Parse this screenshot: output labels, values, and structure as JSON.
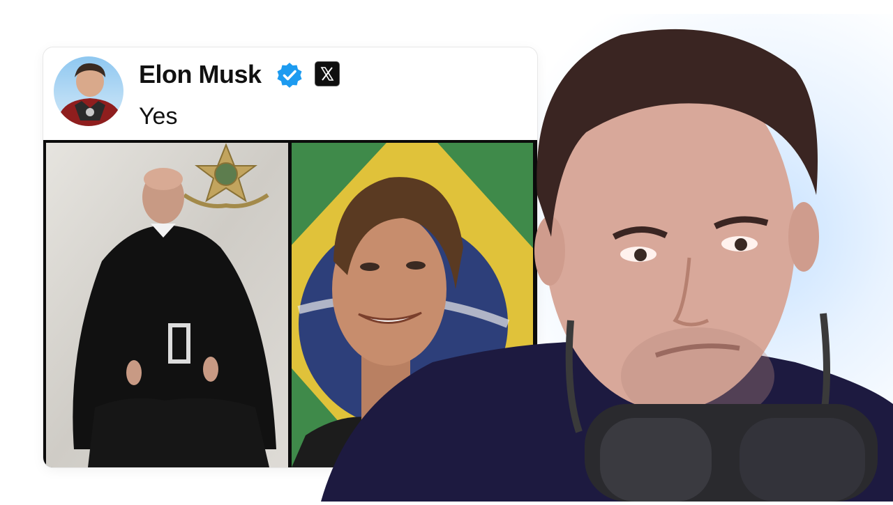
{
  "tweet": {
    "author_name": "Elon Musk",
    "text": "Yes",
    "verified_icon": "verified-badge-icon",
    "platform_icon": "x-logo-icon",
    "media": [
      {
        "icon": "photo-robed-judge"
      },
      {
        "icon": "photo-elon-smiling-brazil-flag"
      }
    ]
  },
  "colors": {
    "verified_blue": "#1d9bf0",
    "card_border": "#e7e7e7",
    "text": "#111111"
  }
}
